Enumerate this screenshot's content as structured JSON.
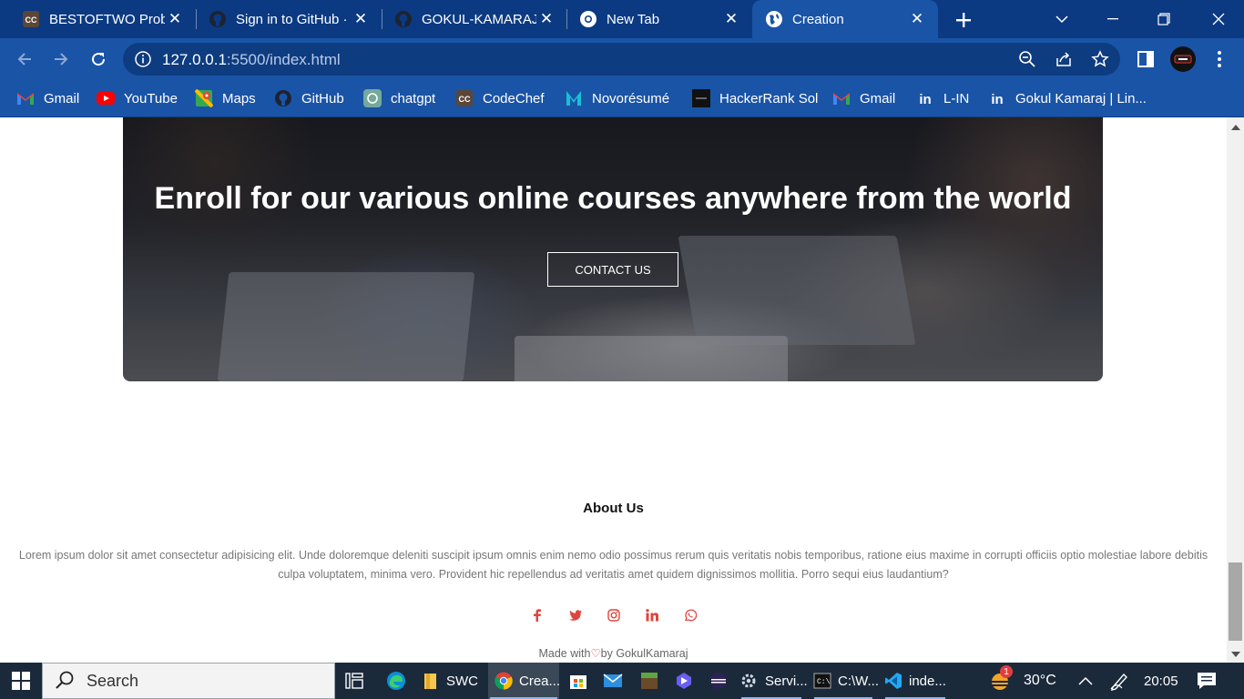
{
  "browser": {
    "tabs": [
      {
        "title": "BESTOFTWO Probl",
        "favicon": "codechef-icon"
      },
      {
        "title": "Sign in to GitHub ·",
        "favicon": "github-icon"
      },
      {
        "title": "GOKUL-KAMARAJ/",
        "favicon": "github-icon"
      },
      {
        "title": "New Tab",
        "favicon": "chrome-icon"
      },
      {
        "title": "Creation",
        "favicon": "globe-icon",
        "active": true
      }
    ],
    "url_host": "127.0.0.1",
    "url_rest": ":5500/index.html",
    "bookmarks": [
      {
        "label": "Gmail",
        "icon": "gmail-icon"
      },
      {
        "label": "YouTube",
        "icon": "youtube-icon"
      },
      {
        "label": "Maps",
        "icon": "maps-icon"
      },
      {
        "label": "GitHub",
        "icon": "github-icon"
      },
      {
        "label": "chatgpt",
        "icon": "chatgpt-icon"
      },
      {
        "label": "CodeChef",
        "icon": "codechef-icon"
      },
      {
        "label": "Novorésumé",
        "icon": "novoresume-icon"
      },
      {
        "label": "HackerRank Sol",
        "icon": "hackerrank-icon"
      },
      {
        "label": "Gmail",
        "icon": "gmail-icon"
      },
      {
        "label": "L-IN",
        "icon": "linkedin-icon"
      },
      {
        "label": "Gokul Kamaraj | Lin...",
        "icon": "linkedin-icon"
      }
    ]
  },
  "page": {
    "hero_heading": "Enroll for our various online courses anywhere from the world",
    "hero_button": "CONTACT US",
    "about_title": "About Us",
    "about_text": "Lorem ipsum dolor sit amet consectetur adipisicing elit. Unde doloremque deleniti suscipit ipsum omnis enim nemo odio possimus rerum quis veritatis nobis temporibus, ratione eius maxime in corrupti officiis optio molestiae labore debitis culpa voluptatem, minima vero. Provident hic repellendus ad veritatis amet quidem dignissimos mollitia. Porro sequi eius laudantium?",
    "social_icons": [
      "facebook-icon",
      "twitter-icon",
      "instagram-icon",
      "linkedin-icon",
      "whatsapp-icon"
    ],
    "footer_made": "Made with",
    "footer_by": "by GokulKamaraj",
    "accent_color": "#e0443e"
  },
  "taskbar": {
    "search_placeholder": "Search",
    "apps": [
      {
        "label": "SWC",
        "icon": "folder-icon"
      },
      {
        "label": "Crea...",
        "icon": "chrome-icon"
      },
      {
        "label": "Servi...",
        "icon": "services-gear-icon"
      },
      {
        "label": "C:\\W...",
        "icon": "cmd-icon"
      },
      {
        "label": "inde...",
        "icon": "vscode-icon"
      }
    ],
    "weather_temp": "30°C",
    "weather_badge": "1",
    "clock": "20:05"
  }
}
